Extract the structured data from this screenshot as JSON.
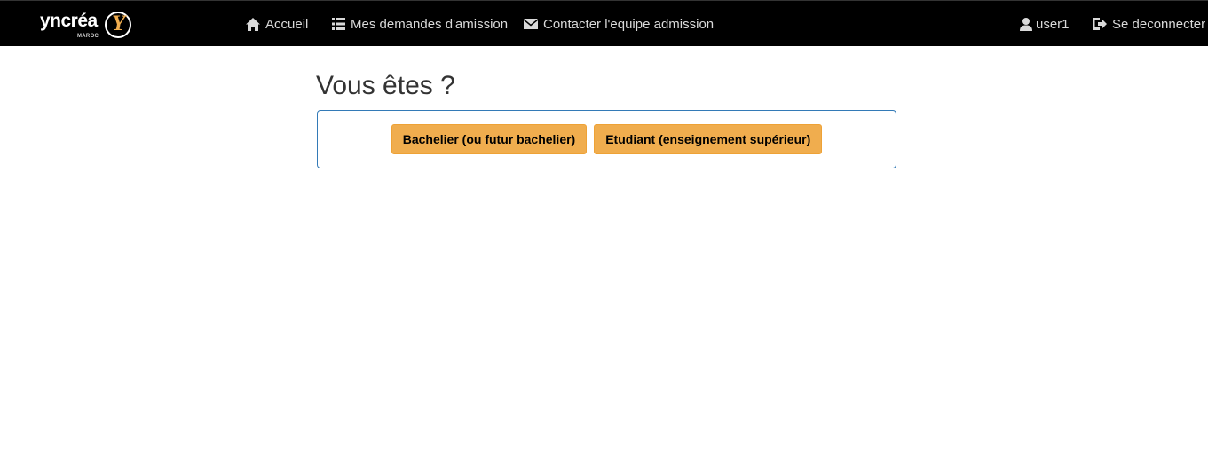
{
  "brand": {
    "name": "yncréa",
    "sub": "MAROC",
    "logo_letter": "Y",
    "accent_color": "#f0ad4e"
  },
  "nav": {
    "home": {
      "label": "Accueil",
      "icon": "home-icon"
    },
    "requests": {
      "label": "Mes demandes d'amission",
      "icon": "list-icon"
    },
    "contact": {
      "label": "Contacter l'equipe admission",
      "icon": "envelope-icon"
    },
    "user": {
      "label": "user1",
      "icon": "user-icon"
    },
    "logout": {
      "label": "Se deconnecter",
      "icon": "logout-icon"
    }
  },
  "main": {
    "title": "Vous êtes ?",
    "choices": {
      "bachelier": "Bachelier (ou futur bachelier)",
      "etudiant": "Etudiant (enseignement supérieur)"
    }
  },
  "colors": {
    "navbar_bg": "#000000",
    "button_bg": "#f0ad4e",
    "panel_border": "#337ab7"
  }
}
